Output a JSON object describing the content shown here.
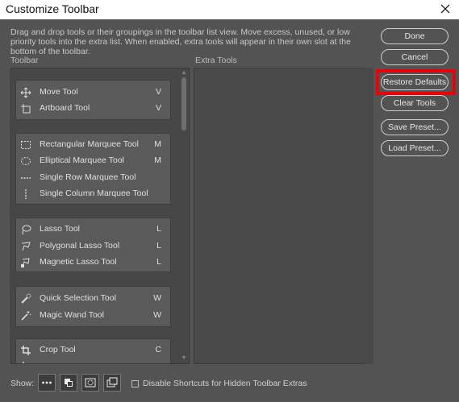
{
  "window": {
    "title": "Customize Toolbar"
  },
  "description": "Drag and drop tools or their groupings in the toolbar list view. Move excess, unused, or low priority tools into the extra list. When enabled, extra tools will appear in their own slot at the bottom of the toolbar.",
  "toolbar_label": "Toolbar",
  "extra_label": "Extra Tools",
  "groups": [
    {
      "tools": [
        {
          "label": "Move Tool",
          "key": "V",
          "icon": "move-icon"
        },
        {
          "label": "Artboard Tool",
          "key": "V",
          "icon": "artboard-icon"
        }
      ]
    },
    {
      "tools": [
        {
          "label": "Rectangular Marquee Tool",
          "key": "M",
          "icon": "rect-marquee-icon"
        },
        {
          "label": "Elliptical Marquee Tool",
          "key": "M",
          "icon": "ellipse-marquee-icon"
        },
        {
          "label": "Single Row Marquee Tool",
          "key": "",
          "icon": "single-row-icon"
        },
        {
          "label": "Single Column Marquee Tool",
          "key": "",
          "icon": "single-column-icon"
        }
      ]
    },
    {
      "tools": [
        {
          "label": "Lasso Tool",
          "key": "L",
          "icon": "lasso-icon"
        },
        {
          "label": "Polygonal Lasso Tool",
          "key": "L",
          "icon": "polygonal-lasso-icon"
        },
        {
          "label": "Magnetic Lasso Tool",
          "key": "L",
          "icon": "magnetic-lasso-icon"
        }
      ]
    },
    {
      "tools": [
        {
          "label": "Quick Selection Tool",
          "key": "W",
          "icon": "quick-selection-icon"
        },
        {
          "label": "Magic Wand Tool",
          "key": "W",
          "icon": "magic-wand-icon"
        }
      ]
    },
    {
      "tools": [
        {
          "label": "Crop Tool",
          "key": "C",
          "icon": "crop-icon"
        }
      ]
    }
  ],
  "buttons": {
    "done": "Done",
    "cancel": "Cancel",
    "restore": "Restore Defaults",
    "clear": "Clear Tools",
    "save": "Save Preset...",
    "load": "Load Preset..."
  },
  "show_label": "Show:",
  "disable_shortcuts": "Disable Shortcuts for Hidden Toolbar Extras",
  "colors": {
    "background": "#535353",
    "highlight": "#e8000b"
  }
}
